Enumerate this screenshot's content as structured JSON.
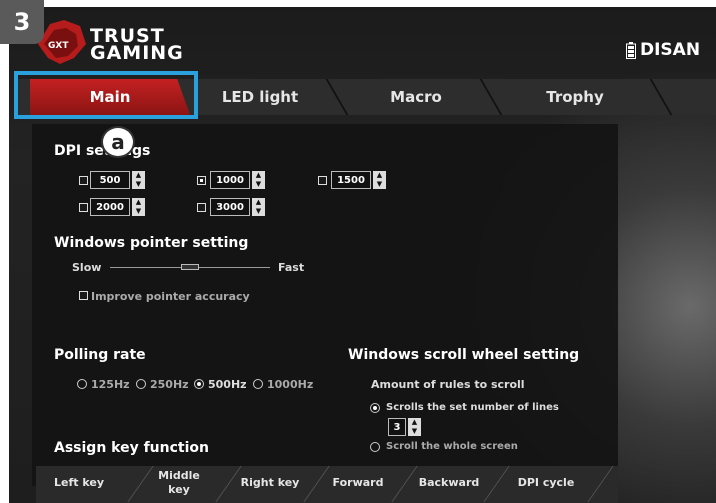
{
  "step_number": "3",
  "callout_letter": "a",
  "brand": {
    "line1": "TRUST",
    "line2": "GAMING",
    "logo_icon": "gxt-scorpion-logo"
  },
  "device_name": "DISAN",
  "battery_icon": "battery-icon",
  "tabs": [
    {
      "label": "Main",
      "active": true
    },
    {
      "label": "LED light"
    },
    {
      "label": "Macro"
    },
    {
      "label": "Trophy"
    }
  ],
  "dpi": {
    "title": "DPI settings",
    "levels": [
      {
        "value": "500",
        "checked": false
      },
      {
        "value": "1000",
        "checked": true
      },
      {
        "value": "1500",
        "checked": false
      },
      {
        "value": "2000",
        "checked": false
      },
      {
        "value": "3000",
        "checked": false
      }
    ]
  },
  "pointer": {
    "title": "Windows pointer setting",
    "slow": "Slow",
    "fast": "Fast",
    "speed_fraction": 0.5,
    "accuracy_label": "Improve pointer accuracy"
  },
  "polling": {
    "title": "Polling rate",
    "options": [
      "125Hz",
      "250Hz",
      "500Hz",
      "1000Hz"
    ],
    "selected": "500Hz"
  },
  "scroll": {
    "title": "Windows scroll wheel setting",
    "subtitle": "Amount of rules to scroll",
    "option1": "Scrolls the set number of lines",
    "lines": "3",
    "option2": "Scroll the whole screen"
  },
  "assign": {
    "title": "Assign key function",
    "keys": [
      "Left key",
      "Middle key",
      "Right key",
      "Forward",
      "Backward",
      "DPI cycle"
    ]
  },
  "colors": {
    "accent_red": "#c42121",
    "highlight_blue": "#2aa0dc"
  }
}
